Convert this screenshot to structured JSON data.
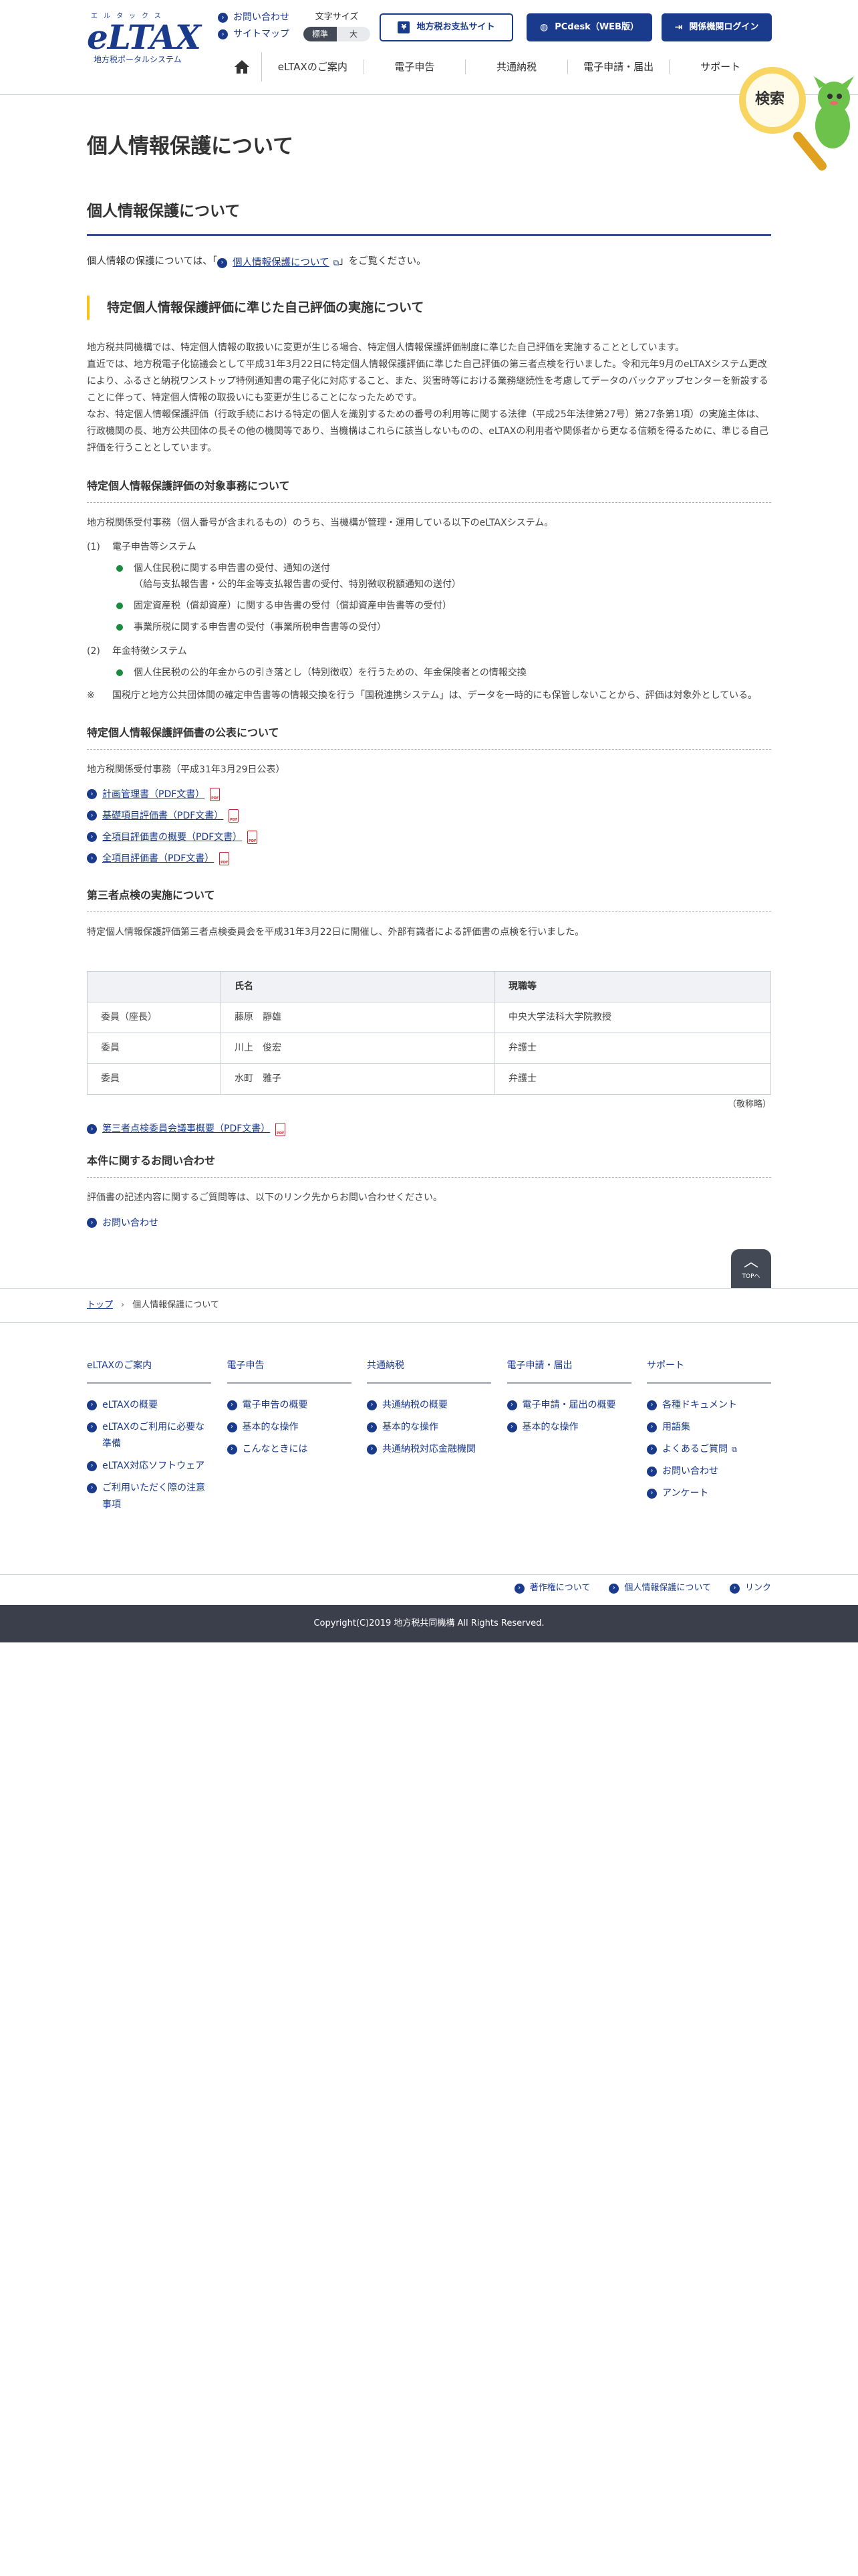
{
  "header": {
    "logo_kana": "エルタックス",
    "logo_text": "eLTAX",
    "logo_sub": "地方税ポータルシステム",
    "util_links": [
      "お問い合わせ",
      "サイトマップ"
    ],
    "font_size_label": "文字サイズ",
    "font_size_options": [
      "標準",
      "大"
    ],
    "buttons": {
      "local_tax_payment": "地方税お支払サイト",
      "pcdesk": "PCdesk（WEB版）",
      "login": "関係機関ログイン"
    },
    "nav": [
      "eLTAXのご案内",
      "電子申告",
      "共通納税",
      "電子申請・届出",
      "サポート"
    ],
    "search_label": "検索"
  },
  "main": {
    "page_title": "個人情報保護について",
    "section_title": "個人情報保護について",
    "intro_before": "個人情報の保護については、「",
    "intro_link": "個人情報保護について",
    "intro_after": "」をご覧ください。",
    "assessment": {
      "title": "特定個人情報保護評価に準じた自己評価の実施について",
      "paragraph": "地方税共同機構では、特定個人情報の取扱いに変更が生じる場合、特定個人情報保護評価制度に準じた自己評価を実施することとしています。\n直近では、地方税電子化協議会として平成31年3月22日に特定個人情報保護評価に準じた自己評価の第三者点検を行いました。令和元年9月のeLTAXシステム更改により、ふるさと納税ワンストップ特例通知書の電子化に対応すること、また、災害時等における業務継続性を考慮してデータのバックアップセンターを新設することに伴って、特定個人情報の取扱いにも変更が生じることになったためです。\nなお、特定個人情報保護評価（行政手続における特定の個人を識別するための番号の利用等に関する法律（平成25年法律第27号）第27条第1項）の実施主体は、行政機関の長、地方公共団体の長その他の機関等であり、当機構はこれらに該当しないものの、eLTAXの利用者や関係者から更なる信頼を得るために、準じる自己評価を行うこととしています。"
    },
    "target": {
      "title": "特定個人情報保護評価の対象事務について",
      "text": "地方税関係受付事務（個人番号が含まれるもの）のうち、当機構が管理・運用している以下のeLTAXシステム。",
      "items": [
        {
          "num": "(1)",
          "label": "電子申告等システム",
          "subs": [
            "個人住民税に関する申告書の受付、通知の送付\n（給与支払報告書・公的年金等支払報告書の受付、特別徴収税額通知の送付）",
            "固定資産税（償却資産）に関する申告書の受付（償却資産申告書等の受付）",
            "事業所税に関する申告書の受付（事業所税申告書等の受付）"
          ]
        },
        {
          "num": "(2)",
          "label": "年金特徴システム",
          "subs": [
            "個人住民税の公的年金からの引き落とし（特別徴収）を行うための、年金保険者との情報交換"
          ]
        }
      ],
      "note_mark": "※",
      "note": "国税庁と地方公共団体間の確定申告書等の情報交換を行う「国税連携システム」は、データを一時的にも保管しないことから、評価は対象外としている。"
    },
    "publication": {
      "title": "特定個人情報保護評価書の公表について",
      "text": "地方税関係受付事務（平成31年3月29日公表）",
      "links": [
        "計画管理書（PDF文書）",
        "基礎項目評価書（PDF文書）",
        "全項目評価書の概要（PDF文書）",
        "全項目評価書（PDF文書）"
      ],
      "pdf_label": "PDF"
    },
    "third_party": {
      "title": "第三者点検の実施について",
      "text": "特定個人情報保護評価第三者点検委員会を平成31年3月22日に開催し、外部有識者による評価書の点検を行いました。",
      "table_headers": [
        "",
        "氏名",
        "現職等"
      ],
      "table_rows": [
        [
          "委員（座長）",
          "藤原　靜雄",
          "中央大学法科大学院教授"
        ],
        [
          "委員",
          "川上　俊宏",
          "弁護士"
        ],
        [
          "委員",
          "水町　雅子",
          "弁護士"
        ]
      ],
      "honorific": "（敬称略）",
      "minutes_link": "第三者点検委員会議事概要（PDF文書）"
    },
    "inquiry": {
      "title": "本件に関するお問い合わせ",
      "text": "評価書の記述内容に関するご質問等は、以下のリンク先からお問い合わせください。",
      "link": "お問い合わせ"
    }
  },
  "totop_label": "TOPへ",
  "breadcrumb": {
    "top": "トップ",
    "current": "個人情報保護について"
  },
  "footer_nav": [
    {
      "head": "eLTAXのご案内",
      "items": [
        "eLTAXの概要",
        "eLTAXのご利用に必要な準備",
        "eLTAX対応ソフトウェア",
        "ご利用いただく際の注意事項"
      ]
    },
    {
      "head": "電子申告",
      "items": [
        "電子申告の概要",
        "基本的な操作",
        "こんなときには"
      ]
    },
    {
      "head": "共通納税",
      "items": [
        "共通納税の概要",
        "基本的な操作",
        "共通納税対応金融機関"
      ]
    },
    {
      "head": "電子申請・届出",
      "items": [
        "電子申請・届出の概要",
        "基本的な操作"
      ]
    },
    {
      "head": "サポート",
      "items": [
        "各種ドキュメント",
        "用語集",
        "よくあるご質問",
        "お問い合わせ",
        "アンケート"
      ]
    }
  ],
  "bottom_links": [
    "著作権について",
    "個人情報保護について",
    "リンク"
  ],
  "copyright": "Copyright(C)2019 地方税共同機構 All Rights Reserved.",
  "colors": {
    "brand": "#1a3a8c",
    "accent_yellow": "#f4c21a",
    "bullet_green": "#1a8a3c",
    "pdf_red": "#c0282d",
    "footer_bg": "#3a3f4b"
  },
  "icons": [
    "home-icon",
    "arrow-circle-icon",
    "globe-icon",
    "login-icon",
    "external-window-icon",
    "pdf-icon",
    "chevron-up-icon",
    "magnifier-mascot-icon"
  ]
}
